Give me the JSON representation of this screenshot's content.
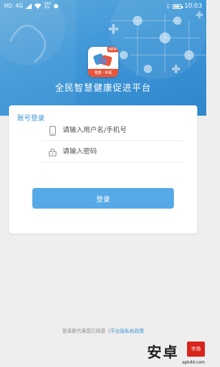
{
  "status_bar": {
    "carrier": "HD",
    "signal": "4G",
    "net_speed_value": "660",
    "net_speed_unit": "B/s",
    "time": "10:03",
    "battery_level": 0.85
  },
  "app": {
    "logo_tag": "NEW",
    "logo_band": "健康 · 幸福",
    "title": "全民智慧健康促进平台"
  },
  "login": {
    "section_title": "账号登录",
    "username_placeholder": "请输入用户名/手机号",
    "password_placeholder": "请输入密码",
    "submit_label": "登录"
  },
  "footer": {
    "agreement_prefix": "登录即代表您已同意《",
    "agreement_link": "平台隐私权政策"
  },
  "watermark": {
    "main": "安卓",
    "badge": "市场",
    "url": "apkdd.com"
  },
  "colors": {
    "header": "#3f97d7",
    "accent": "#3c95d6",
    "button": "#56a9e6",
    "background": "#eeeeee"
  }
}
